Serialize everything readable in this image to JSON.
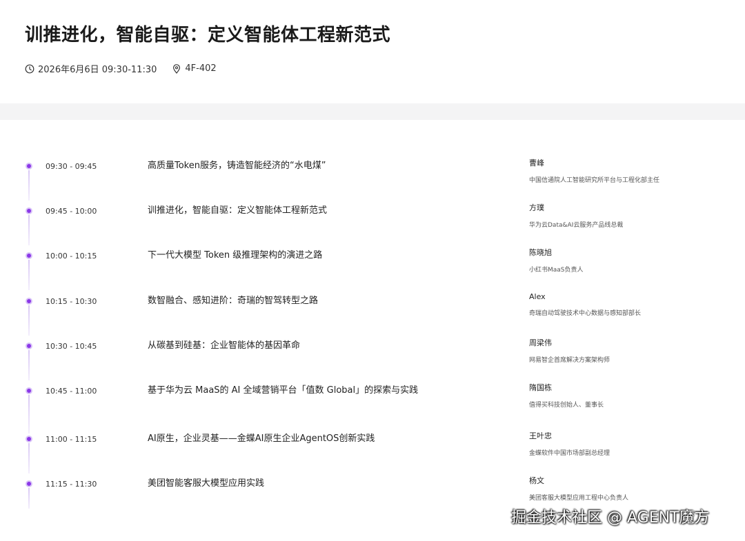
{
  "event": {
    "title": "训推进化，智能自驱：定义智能体工程新范式",
    "datetime": "2026年6月6日 09:30-11:30",
    "location": "4F-402"
  },
  "icons": {
    "datetime": "clock-icon",
    "location": "location-pin-icon"
  },
  "colors": {
    "accent": "#8b36e8",
    "band": "#f4f4f5"
  },
  "agenda": [
    {
      "time": "09:30 - 09:45",
      "topic": "高质量Token服务，铸造智能经济的“水电煤”",
      "speaker": "曹峰",
      "role": "中国信通院人工智能研究所平台与工程化部主任"
    },
    {
      "time": "09:45 - 10:00",
      "topic": "训推进化，智能自驱：定义智能体工程新范式",
      "speaker": "方璞",
      "role": "华为云Data&AI云服务产品线总裁"
    },
    {
      "time": "10:00 - 10:15",
      "topic": "下一代大模型 Token 级推理架构的演进之路",
      "speaker": "陈晓旭",
      "role": "小红书MaaS负责人"
    },
    {
      "time": "10:15 - 10:30",
      "topic": "数智融合、感知进阶：奇瑞的智驾转型之路",
      "speaker": "Alex",
      "role": "奇瑞自动驾驶技术中心数据与感知部部长"
    },
    {
      "time": "10:30 - 10:45",
      "topic": "从碳基到硅基：企业智能体的基因革命",
      "speaker": "周梁伟",
      "role": "网易智企首席解决方案架构师"
    },
    {
      "time": "10:45 - 11:00",
      "topic": "基于华为云 MaaS的 AI 全域营销平台「值数 Global」的探索与实践",
      "speaker": "隋国栋",
      "role": "值得买科技创始人、董事长"
    },
    {
      "time": "11:00 - 11:15",
      "topic": "AI原生，企业灵基——金蝶AI原生企业AgentOS创新实践",
      "speaker": "王叶忠",
      "role": "金蝶软件中国市场部副总经理"
    },
    {
      "time": "11:15 - 11:30",
      "topic": "美团智能客服大模型应用实践",
      "speaker": "杨文",
      "role": "美团客服大模型应用工程中心负责人"
    }
  ],
  "watermark": "掘金技术社区 @ AGENT魔方"
}
